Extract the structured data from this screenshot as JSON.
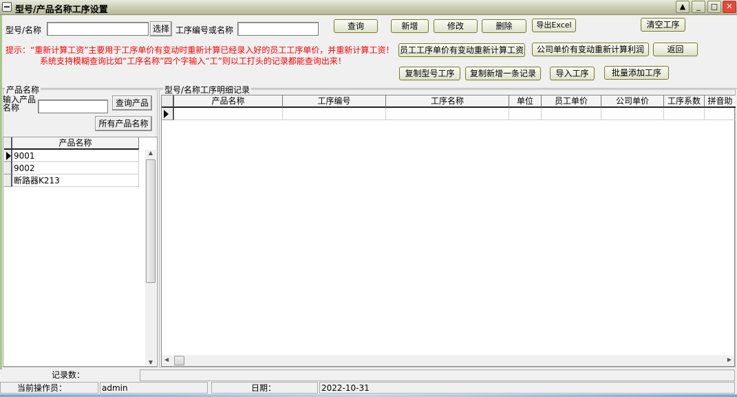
{
  "window": {
    "title": "型号/产品名称工序设置",
    "controls": [
      "▲",
      "_",
      "□",
      "✕"
    ]
  },
  "toolbar": {
    "model_label": "型号/名称",
    "model_value": "",
    "select_btn": "选择",
    "proc_label": "工序编号或名称",
    "proc_value": "",
    "query": "查询",
    "add": "新增",
    "edit": "修改",
    "delete": "删除",
    "export": "导出Excel",
    "clear": "清空工序",
    "recalc_wage": "员工工序单价有变动重新计算工资",
    "recalc_profit": "公司单价有变动重新计算利润",
    "back": "返回",
    "copy_model": "复制型号工序",
    "copy_record": "复制新增一条记录",
    "import": "导入工序",
    "batch_add": "批量添加工序"
  },
  "tips": {
    "line1": "提示：“重新计算工资”主要用于工序单价有变动时重新计算已经录入好的员工工序单价，并重新计算工资！",
    "line2": "系统支持模糊查询比如“工序名称”四个字输入“工”则以工打头的记录都能查询出来！"
  },
  "left": {
    "group_title": "产品名称",
    "input_label": "输入产品名称",
    "input_value": "",
    "query_btn": "查询产品",
    "all_btn": "所有产品名称",
    "header": "产品名称",
    "rows": [
      "9001",
      "9002",
      "断路器K213"
    ]
  },
  "right": {
    "group_title": "型号/名称工序明细记录",
    "columns": [
      "产品名称",
      "工序编号",
      "工序名称",
      "单位",
      "员工单价",
      "公司单价",
      "工序系数",
      "拼音助"
    ]
  },
  "status": {
    "records_label": "记录数：",
    "records_value": "",
    "operator_label": "当前操作员：",
    "operator": "admin",
    "date_label": "日期：",
    "date": "2022-10-31"
  }
}
